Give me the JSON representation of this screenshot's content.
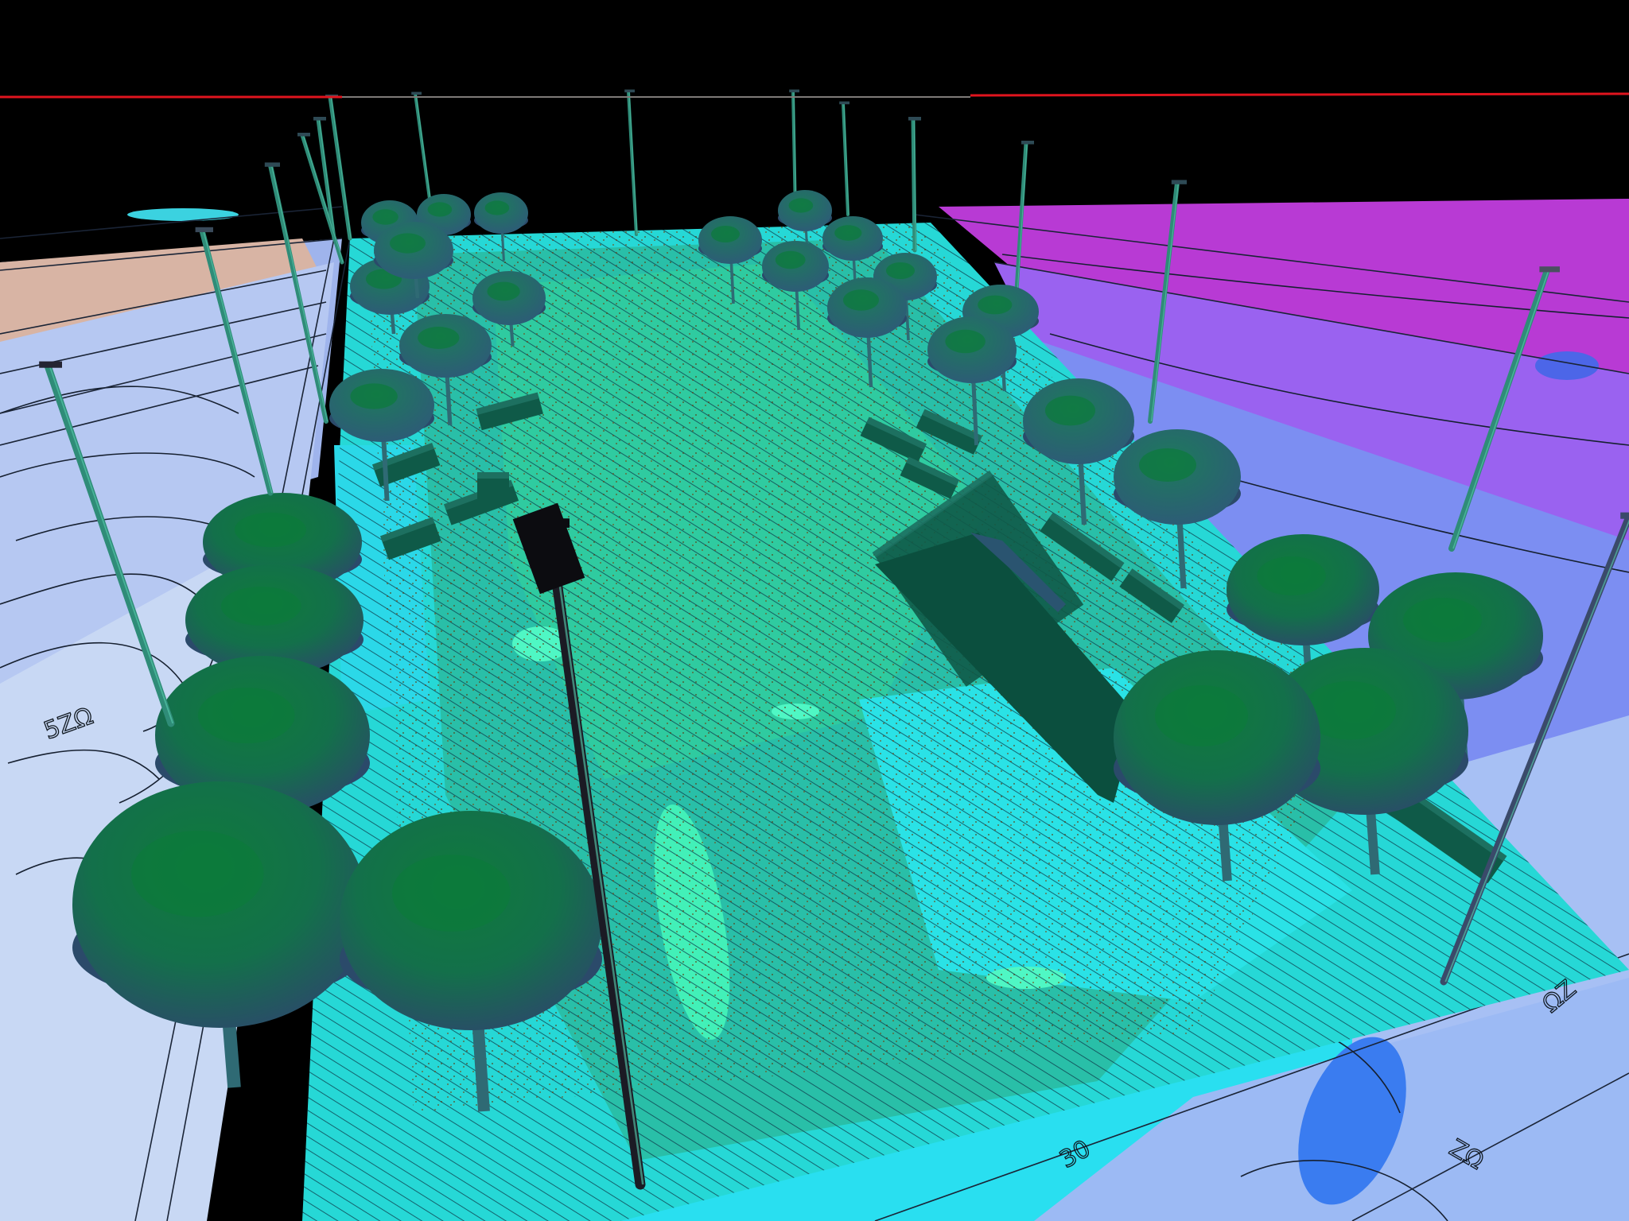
{
  "viewport": {
    "kind": "3d-lighting-visualization",
    "background_color": "#000000",
    "horizon_line_color": "#e0141e"
  },
  "illuminance_palette": {
    "ground_low": "#9fc2f0",
    "ground_pale": "#c4d6f6",
    "ground_warm": "#e4c2a8",
    "ground_blue": "#6f86f0",
    "ground_violet": "#9a64f0",
    "ground_magenta": "#c03ad0",
    "deck_cyan": "#24e6e8",
    "deck_teal": "#26c0ac",
    "deck_mint": "#33dca8",
    "deck_bright": "#4ff7c4",
    "hot_spot_blue": "#3a7cf0"
  },
  "object_colors": {
    "tree_canopy_light": "#0b7a3a",
    "tree_canopy_mid": "#1c6a5e",
    "tree_canopy_dark": "#2b4a6a",
    "tree_trunk": "#2f6a74",
    "light_pole": "#2f8c78",
    "light_pole_dark": "#1b1b24",
    "planter_block": "#0f5a48",
    "leaf_debris": "#6e4410"
  },
  "scene_counts": {
    "light_poles": 17,
    "trees": 28,
    "planter_blocks": 12
  },
  "contour_labels": [
    "ZΩ",
    "30",
    "ΩZ",
    "5ZΩ"
  ]
}
